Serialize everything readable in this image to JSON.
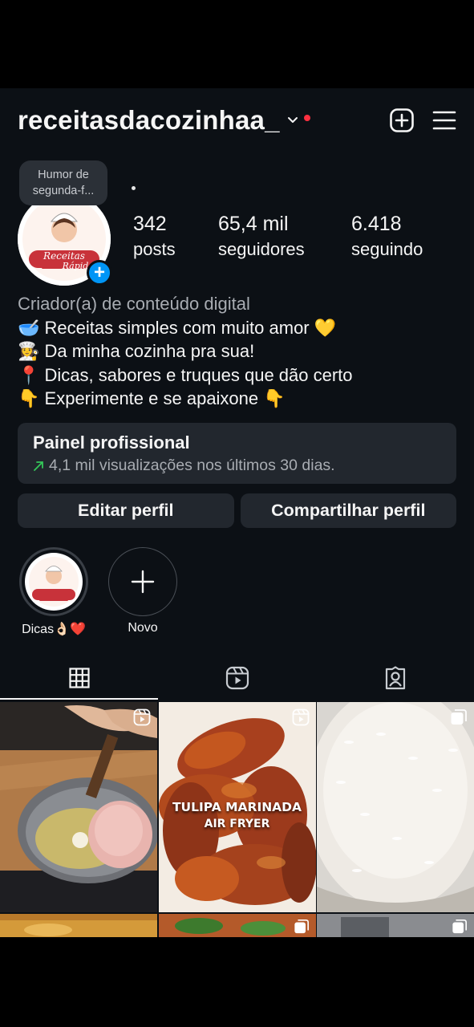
{
  "header": {
    "username": "receitasdacozinhaa_",
    "create_icon": "plus-square-icon",
    "menu_icon": "hamburger-menu-icon"
  },
  "note": {
    "text": "Humor de segunda-f..."
  },
  "note_dot": ".",
  "profile": {
    "avatar_text_line1": "Receitas",
    "avatar_text_line2": "Rápid",
    "add_story_badge": "+"
  },
  "stats": [
    {
      "value": "342",
      "label": "posts"
    },
    {
      "value": "65,4 mil",
      "label": "seguidores"
    },
    {
      "value": "6.418",
      "label": "seguindo"
    }
  ],
  "bio": {
    "category": "Criador(a) de conteúdo digital",
    "lines": [
      {
        "emoji": "🥣",
        "text": "Receitas simples com muito amor 💛"
      },
      {
        "emoji": "👩‍🍳",
        "text": "Da minha cozinha pra sua!"
      },
      {
        "emoji": "📍",
        "text": "Dicas, sabores e truques que dão certo"
      },
      {
        "emoji": "👇",
        "text": "Experimente e se apaixone 👇"
      }
    ]
  },
  "professional_panel": {
    "title": "Painel profissional",
    "subtitle": "4,1 mil visualizações nos últimos 30 dias."
  },
  "buttons": {
    "edit": "Editar perfil",
    "share": "Compartilhar perfil"
  },
  "highlights": [
    {
      "label": "Dicas👌🏻❤️"
    },
    {
      "label": "Novo"
    }
  ],
  "tabs": [
    "grid-icon",
    "reels-icon",
    "tagged-icon"
  ],
  "posts": [
    {
      "type": "reel",
      "badge": "reel-icon"
    },
    {
      "type": "reel",
      "badge": "reel-icon",
      "title_line1": "TULIPA MARINADA",
      "title_line2": "AIR FRYER"
    },
    {
      "type": "carousel",
      "badge": "carousel-icon"
    },
    {
      "type": "post"
    },
    {
      "type": "carousel",
      "badge": "carousel-icon"
    },
    {
      "type": "carousel",
      "badge": "carousel-icon"
    }
  ],
  "colors": {
    "background": "#0c1015",
    "surface": "#22272e",
    "accent_blue": "#0095f6",
    "notification_red": "#ff3040",
    "trend_green": "#34c759"
  }
}
